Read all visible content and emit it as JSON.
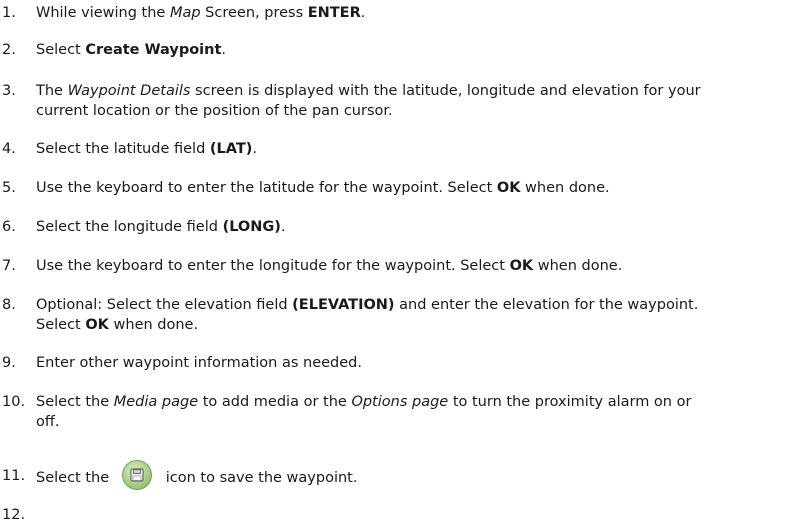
{
  "steps": [
    {
      "num": "1.",
      "segments": [
        {
          "t": "While viewing the "
        },
        {
          "t": "Map",
          "s": "i"
        },
        {
          "t": " Screen, press "
        },
        {
          "t": "ENTER",
          "s": "b"
        },
        {
          "t": "."
        }
      ]
    },
    {
      "num": "2.",
      "segments": [
        {
          "t": "Select "
        },
        {
          "t": "Create Waypoint",
          "s": "b"
        },
        {
          "t": "."
        }
      ]
    },
    {
      "num": "3.",
      "segments": [
        {
          "t": "The "
        },
        {
          "t": "Waypoint Details",
          "s": "i"
        },
        {
          "t": " screen is displayed with the latitude, longitude and elevation for your"
        },
        {
          "br": true
        },
        {
          "t": "current location or the position of the pan cursor."
        }
      ]
    },
    {
      "num": "4.",
      "segments": [
        {
          "t": "Select the latitude field "
        },
        {
          "t": "(LAT)",
          "s": "b"
        },
        {
          "t": "."
        }
      ]
    },
    {
      "num": "5.",
      "segments": [
        {
          "t": "Use the keyboard to enter the latitude for the waypoint.  Select "
        },
        {
          "t": "OK",
          "s": "b"
        },
        {
          "t": " when done."
        }
      ]
    },
    {
      "num": "6.",
      "segments": [
        {
          "t": "Select the longitude field "
        },
        {
          "t": "(LONG)",
          "s": "b"
        },
        {
          "t": "."
        }
      ]
    },
    {
      "num": "7.",
      "segments": [
        {
          "t": "Use the keyboard to enter the longitude for the waypoint.  Select "
        },
        {
          "t": "OK",
          "s": "b"
        },
        {
          "t": " when done."
        }
      ]
    },
    {
      "num": "8.",
      "segments": [
        {
          "t": "Optional:  Select the elevation field "
        },
        {
          "t": "(ELEVATION)",
          "s": "b"
        },
        {
          "t": " and enter the elevation for the waypoint."
        },
        {
          "br": true
        },
        {
          "t": "Select "
        },
        {
          "t": "OK",
          "s": "b"
        },
        {
          "t": " when done."
        }
      ]
    },
    {
      "num": "9.",
      "segments": [
        {
          "t": "Enter other waypoint information as needed."
        }
      ]
    },
    {
      "num": "10.",
      "segments": [
        {
          "t": "Select the "
        },
        {
          "t": "Media page",
          "s": "i"
        },
        {
          "t": " to add media or the "
        },
        {
          "t": "Options page",
          "s": "i"
        },
        {
          "t": " to turn the proximity alarm on or"
        },
        {
          "br": true
        },
        {
          "t": "off."
        }
      ]
    },
    {
      "num": "11.",
      "segments": [
        {
          "t": "Select the "
        },
        {
          "icon": "save-icon"
        },
        {
          "t": "icon to save the waypoint."
        }
      ]
    },
    {
      "num": "12.",
      "segments": []
    }
  ],
  "colors": {
    "text": "#1a1a1a",
    "icon_green": "#a8cf86"
  }
}
